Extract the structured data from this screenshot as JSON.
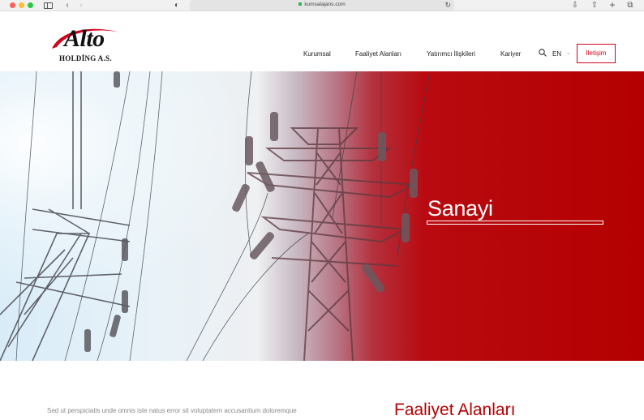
{
  "browser": {
    "url": "kumsalajans.com",
    "icons": [
      "sidebar-icon",
      "back-icon",
      "forward-icon",
      "shield-icon",
      "lock-icon",
      "reload-icon",
      "download-icon",
      "share-icon",
      "new-tab-icon",
      "tabs-icon"
    ]
  },
  "header": {
    "logo_word": "Alto",
    "logo_sub": "HOLDİNG A.S.",
    "nav": {
      "kurumsal": "Kurumsal",
      "faaliyet": "Faaliyet Alanları",
      "yatirimci": "Yatırımcı İlişkileri",
      "kariyer": "Kariyer"
    },
    "lang": "EN",
    "contact": "İletişim"
  },
  "hero": {
    "title": "Sanayi"
  },
  "content": {
    "intro": "Sed ut perspiciatis unde omnis iste natus error sit voluptatem accusantium doloremque",
    "section_title": "Faaliyet Alanları"
  },
  "colors": {
    "brand_red": "#b40000",
    "accent_red": "#d0021b"
  }
}
